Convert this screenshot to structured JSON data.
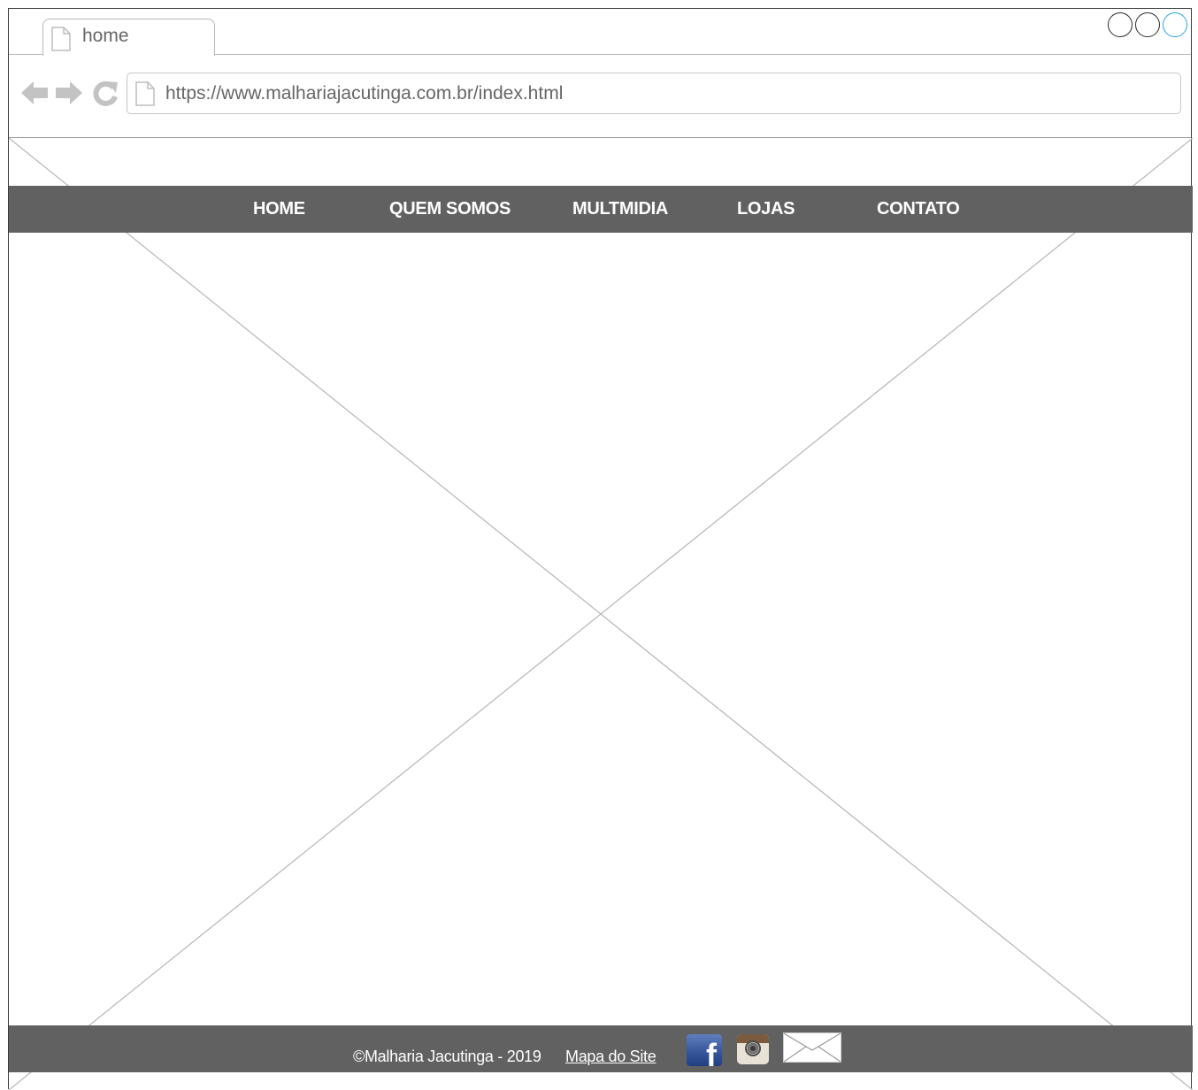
{
  "browser": {
    "tab_title": "home",
    "url": "https://www.malhariajacutinga.com.br/index.html",
    "window_buttons": [
      "minimize",
      "maximize",
      "close"
    ],
    "active_button_color": "#29a3e8"
  },
  "menu": {
    "items": [
      {
        "label": "HOME"
      },
      {
        "label": "QUEM SOMOS"
      },
      {
        "label": "MULTMIDIA"
      },
      {
        "label": "LOJAS"
      },
      {
        "label": "CONTATO"
      }
    ],
    "background_color": "#616161"
  },
  "footer": {
    "copyright": "©Malharia Jacutinga - 2019",
    "sitemap_link": "Mapa do Site",
    "icons": [
      "facebook-icon",
      "instagram-icon",
      "email-icon"
    ],
    "background_color": "#616161"
  },
  "icons": {
    "back": "back-arrow-icon",
    "forward": "forward-arrow-icon",
    "reload": "reload-icon",
    "page": "page-icon"
  }
}
